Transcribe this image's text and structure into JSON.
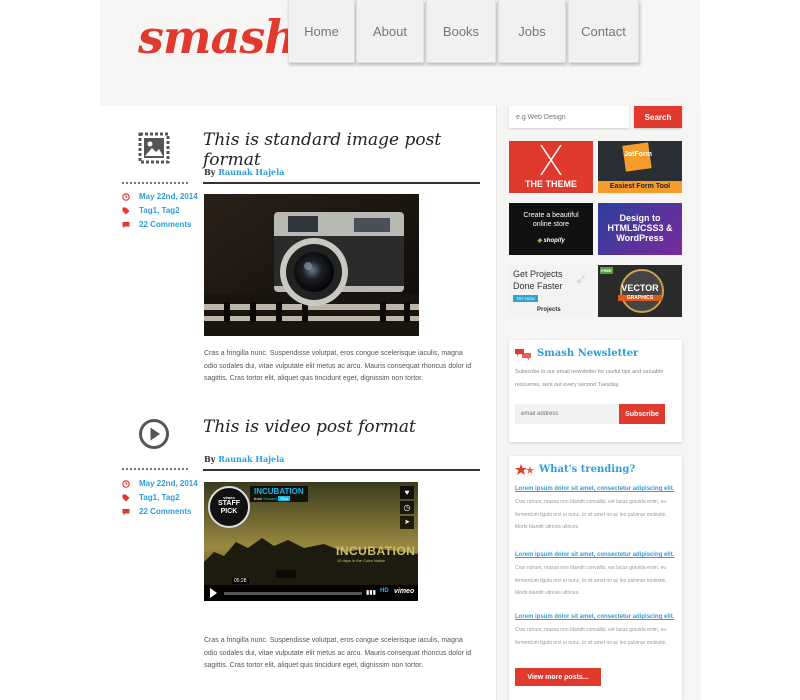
{
  "site": {
    "logo": "smash",
    "nav": [
      "Home",
      "About",
      "Books",
      "Jobs",
      "Contact"
    ]
  },
  "posts": [
    {
      "title": "This is standard image post format",
      "byline_prefix": "By",
      "author": "Raunak Hajela",
      "date": "May 22nd, 2014",
      "tags": "Tag1, Tag2",
      "comments": "22 Comments",
      "excerpt": "Cras a fringilla nunc. Suspendisse volutpat, eros congue scelerisque iaculis, magna odio sodales dui, vitae vulputate elit metus ac arcu. Mauris consequat rhoncus dolor id sagittis. Cras tortor elit, aliquet quis tincidunt eget, dignissim non tortor."
    },
    {
      "title": "This is video post format",
      "byline_prefix": "By",
      "author": "Raunak Hajela",
      "date": "May 22nd, 2014",
      "tags": "Tag1, Tag2",
      "comments": "22 Comments",
      "excerpt": "Cras a fringilla nunc. Suspendisse volutpat, eros congue scelerisque iaculis, magna odio sodales dui, vitae vulputate elit metus ac arcu. Mauris consequat rhoncus dolor id sagittis. Cras tortor elit, aliquet quis tincidunt eget, dignissim non tortor."
    }
  ],
  "video": {
    "title": "INCUBATION",
    "from_prefix": "from",
    "from_name": "Selsaris",
    "plus_badge": "Plus",
    "badge_top": "vimeo",
    "badge_mid": "STAFF",
    "badge_bot": "PICK",
    "overlay_title": "INCUBATION",
    "overlay_sub": "10 days in the Cuba Nation",
    "time": "05:28",
    "hd": "HD",
    "brand": "vimeo"
  },
  "sidebar": {
    "search_placeholder": "e.g Web Design",
    "search_button": "Search",
    "ads": {
      "theme": "THE THEME",
      "jotform_name": "JotForm",
      "jotform_sub": "Easiest Form Tool",
      "shopify_text": "Create a beautiful online store",
      "shopify_brand": "shopify",
      "html5_text": "Design to HTML5/CSS3 & WordPress",
      "projects_title": "Get Projects Done Faster",
      "projects_try": "TRY NOW",
      "projects_brand": "Projects",
      "vector_free": "FREE",
      "vector_title": "VECTOR",
      "vector_sub": "GRAPHICS"
    },
    "newsletter": {
      "title": "Smash Newsletter",
      "text": "Subscribe to our email newsletter for useful tips and valuable resources, sent out every second Tuesday.",
      "placeholder": "email address",
      "button": "Subscribe"
    },
    "trending": {
      "title": "What's trending?",
      "items": [
        {
          "link": "Lorem ipsum dolor sit amet, consectetur adipiscing elit.",
          "text": "Cras rutrum, massa non blandit convallis, est lacus gravida enim, eu fermentum ligula orci et nunc. In sit amet mi ac leo pulvinar molestie. Morbi blandit ultrices ultrices."
        },
        {
          "link": "Lorem ipsum dolor sit amet, consectetur adipiscing elit.",
          "text": "Cras rutrum, massa non blandit convallis, est lacus gravida enim, eu fermentum ligula orci et nunc. In sit amet mi ac leo pulvinar molestie. Morbi blandit ultrices ultrices."
        },
        {
          "link": "Lorem ipsum dolor sit amet, consectetur adipiscing elit.",
          "text": "Cras rutrum, massa non blandit convallis, est lacus gravida enim, eu fermentum ligula orci et nunc. In sit amet mi ac leo pulvinar molestie."
        }
      ],
      "button": "View more posts..."
    }
  },
  "colors": {
    "accent": "#e03a2f",
    "link": "#2f9ed8"
  }
}
